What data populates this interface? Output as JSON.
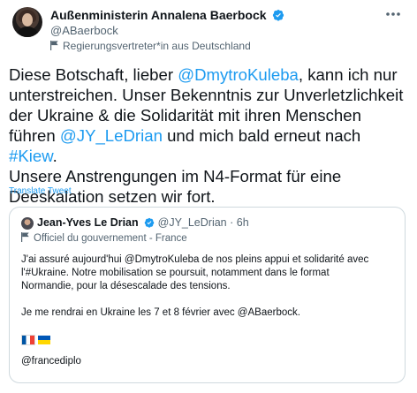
{
  "author": {
    "name": "Außenministerin Annalena Baerbock",
    "handle": "@ABaerbock",
    "label": "Regierungsvertreter*in aus Deutschland"
  },
  "tweet": {
    "text_parts": [
      "Diese Botschaft, lieber ",
      "@DmytroKuleba",
      ", kann ich nur\nunterstreichen. Unser Bekenntnis zur Unverletzlichkeit\nder Ukraine & die Solidarität mit ihren Menschen\nführen ",
      "@JY_LeDrian",
      " und mich bald erneut nach ",
      "#Kiew",
      ".\nUnsere Anstrengungen im N4-Format für eine\nDeeskalation setzen wir fort."
    ],
    "translate": "Translate Tweet"
  },
  "quoted": {
    "name": "Jean-Yves Le Drian",
    "handle": "@JY_LeDrian",
    "sep": "·",
    "time": "6h",
    "label": "Officiel du gouvernement - France",
    "text": "J'ai assuré aujourd'hui @DmytroKuleba de nos pleins appui et solidarité avec\nl'#Ukraine. Notre mobilisation se poursuit, notamment dans le format\nNormandie, pour la désescalade des tensions.\n\nJe me rendrai en Ukraine les 7 et 8 février avec @ABaerbock.",
    "footer": "@francediplo"
  },
  "icons": {
    "verified": "verified-badge-icon",
    "more": "more-icon",
    "government_label": "flag-icon"
  },
  "colors": {
    "accent": "#1d9bf0",
    "secondary_text": "#536471",
    "border": "#cfd9de"
  }
}
